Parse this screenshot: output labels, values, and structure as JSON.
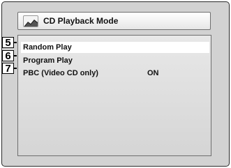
{
  "menu": {
    "title": "CD Playback Mode",
    "title_icon": "cd-playback-icon",
    "items": [
      {
        "label": "Random Play",
        "value": "",
        "selected": true
      },
      {
        "label": "Program Play",
        "value": "",
        "selected": false
      },
      {
        "label": "PBC (Video CD only)",
        "value": "ON",
        "selected": false
      }
    ]
  },
  "callouts": [
    "5",
    "6",
    "7"
  ],
  "colors": {
    "screen_bg": "#d2d2d2",
    "panel_bg": "#e0e0e0",
    "highlight": "#ffffff",
    "text": "#111111"
  }
}
